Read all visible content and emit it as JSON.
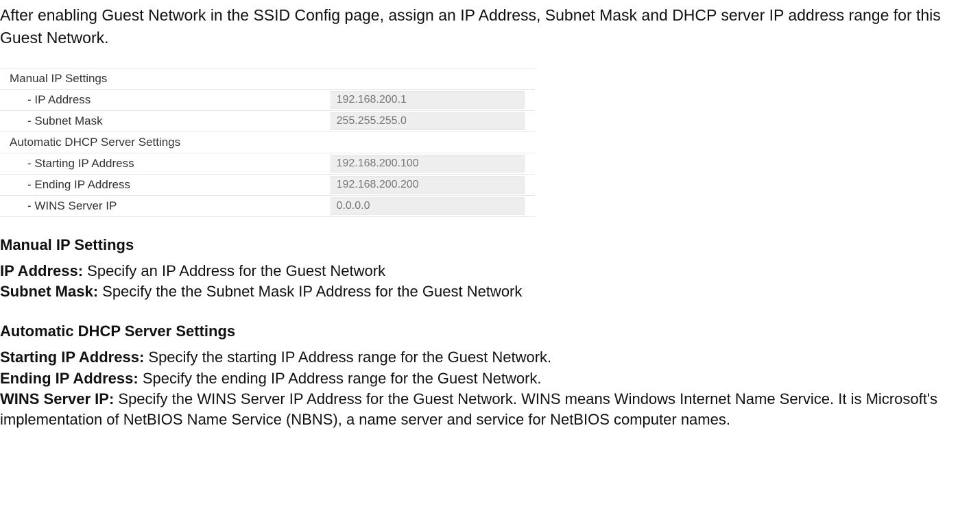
{
  "intro": "After enabling Guest Network in the SSID Config page, assign an IP Address, Subnet Mask and DHCP server IP address range for this Guest Network.",
  "table": {
    "manual_header": "Manual IP Settings",
    "ip_address_label": "- IP Address",
    "ip_address_value": "192.168.200.1",
    "subnet_mask_label": "- Subnet Mask",
    "subnet_mask_value": "255.255.255.0",
    "dhcp_header": "Automatic DHCP Server Settings",
    "starting_ip_label": "- Starting IP Address",
    "starting_ip_value": "192.168.200.100",
    "ending_ip_label": "- Ending IP Address",
    "ending_ip_value": "192.168.200.200",
    "wins_label": "- WINS Server IP",
    "wins_value": "0.0.0.0"
  },
  "sections": {
    "manual": {
      "heading": "Manual IP Settings",
      "ip_term": "IP Address:",
      "ip_desc": " Specify an IP Address for the Guest Network",
      "subnet_term": "Subnet Mask:",
      "subnet_desc": " Specify the the Subnet Mask IP Address for the Guest Network"
    },
    "dhcp": {
      "heading": "Automatic DHCP Server Settings",
      "start_term": "Starting IP Address:",
      "start_desc": " Specify the starting IP Address range for the Guest Network.",
      "end_term": "Ending IP Address:",
      "end_desc": " Specify the ending IP Address range for the Guest Network.",
      "wins_term": "WINS Server IP:",
      "wins_desc": " Specify the WINS Server IP Address for the Guest Network. WINS means Windows Internet Name Service. It is Microsoft's implementation of NetBIOS Name Service (NBNS), a name server and service for NetBIOS computer names."
    }
  }
}
